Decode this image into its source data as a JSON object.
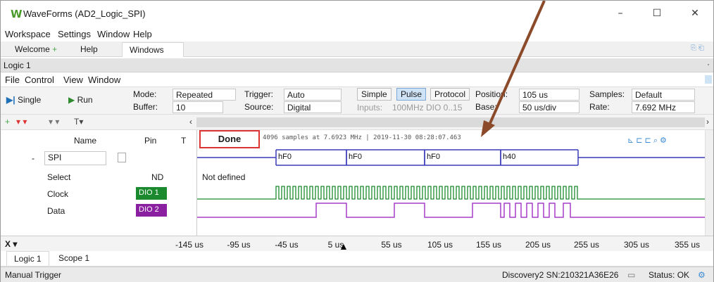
{
  "window": {
    "title": "WaveForms (AD2_Logic_SPI)",
    "minimize": "–",
    "maximize": "☐",
    "close": "✕"
  },
  "menu": [
    "Workspace",
    "Settings",
    "Window",
    "Help"
  ],
  "tabs": {
    "welcome": "Welcome",
    "welcome_plus": "+",
    "help": "Help",
    "windows": "Windows",
    "right_icons": "⎘ ⎗"
  },
  "document": {
    "title": "Logic 1",
    "dot": "·"
  },
  "submenu": [
    "File",
    "Control",
    "View",
    "Window"
  ],
  "controls": {
    "single": "Single",
    "run": "Run",
    "mode_label": "Mode:",
    "mode_value": "Repeated",
    "buffer_label": "Buffer:",
    "buffer_value": "10",
    "trigger_label": "Trigger:",
    "trigger_value": "Auto",
    "source_label": "Source:",
    "source_value": "Digital",
    "simple": "Simple",
    "pulse": "Pulse",
    "protocol": "Protocol",
    "inputs_label": "Inputs:",
    "inputs_value": "100MHz DIO 0..15",
    "position_label": "Position:",
    "position_value": "105 us",
    "base_label": "Base:",
    "base_value": "50 us/div",
    "samples_label": "Samples:",
    "samples_value": "Default",
    "rate_label": "Rate:",
    "rate_value": "7.692 MHz"
  },
  "channels": {
    "name_header": "Name",
    "pin_header": "Pin",
    "t_header": "T",
    "rows": [
      {
        "name": "SPI",
        "pin": "",
        "expander": "-"
      },
      {
        "name": "Select",
        "pin": "ND"
      },
      {
        "name": "Clock",
        "pin": "DIO 1",
        "color": "#1b8a2e"
      },
      {
        "name": "Data",
        "pin": "DIO 2",
        "color": "#8a1fa0"
      }
    ]
  },
  "plot": {
    "status": "Done",
    "info": "4096 samples at 7.6923 MHz | 2019-11-30 08:28:07.463",
    "not_defined": "Not defined",
    "spi_words": [
      "hF0",
      "hF0",
      "hF0",
      "h40"
    ],
    "colors": {
      "spi": "#3a3ab8",
      "clock": "#1b8a2e",
      "data": "#a63ec8"
    }
  },
  "xaxis": {
    "menu": "X",
    "ticks": [
      "-145 us",
      "-95 us",
      "-45 us",
      "5 us",
      "55 us",
      "105 us",
      "155 us",
      "205 us",
      "255 us",
      "305 us",
      "355 us"
    ]
  },
  "bottom_tabs": [
    "Logic 1",
    "Scope 1"
  ],
  "statusbar": {
    "left": "Manual Trigger",
    "device": "Discovery2 SN:210321A36E26",
    "status": "Status: OK"
  }
}
